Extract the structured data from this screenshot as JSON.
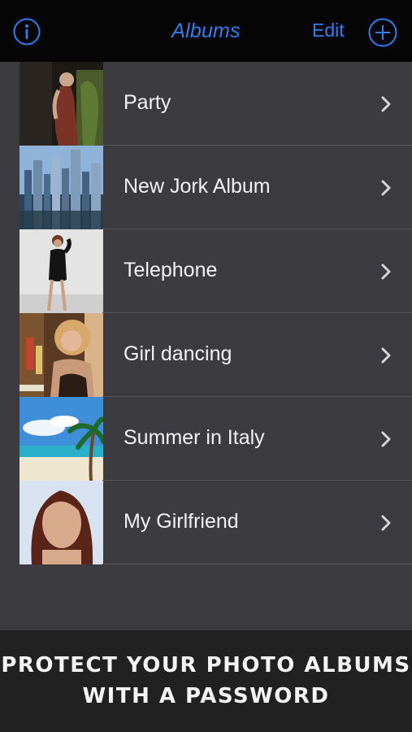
{
  "navbar": {
    "title": "Albums",
    "edit_label": "Edit",
    "info_icon": "info-circle-icon",
    "add_icon": "plus-circle-icon",
    "accent_color": "#2f7ff2"
  },
  "albums": [
    {
      "name": "Party",
      "thumb": "woman-in-dress-photo"
    },
    {
      "name": "New Jork Album",
      "thumb": "city-skyline-photo"
    },
    {
      "name": "Telephone",
      "thumb": "woman-black-dress-photo"
    },
    {
      "name": "Girl dancing",
      "thumb": "woman-party-photo"
    },
    {
      "name": "Summer in Italy",
      "thumb": "beach-palm-photo"
    },
    {
      "name": "My Girlfriend",
      "thumb": "woman-portrait-photo"
    }
  ],
  "promo": {
    "line1": "PROTECT YOUR PHOTO ALBUMS",
    "line2": "WITH A PASSWORD"
  }
}
